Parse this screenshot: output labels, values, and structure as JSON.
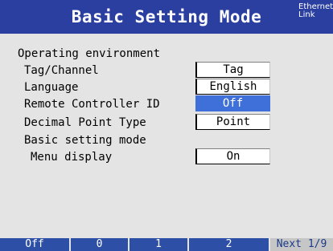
{
  "header": {
    "title": "Basic Setting Mode",
    "status_line1": "Ethernet",
    "status_line2": "Link",
    "bg_color": "#2a3fa0"
  },
  "settings": {
    "section_heading": "Operating environment",
    "tag_channel": {
      "label": "Tag/Channel",
      "value": "Tag"
    },
    "language": {
      "label": "Language",
      "value": "English"
    },
    "remote_controller_id": {
      "label": "Remote Controller ID",
      "value": "Off"
    },
    "decimal_point_type": {
      "label": "Decimal Point Type",
      "value": "Point"
    },
    "basic_mode_heading": "Basic setting mode",
    "menu_display": {
      "label": "Menu display",
      "value": "On"
    }
  },
  "softkeys": [
    "Off",
    "0",
    "1",
    "2",
    "Next 1/9"
  ],
  "colors": {
    "selected_field": "#3f6fd8",
    "softkey": "#2d4fa6",
    "background": "#e4e4e4"
  }
}
